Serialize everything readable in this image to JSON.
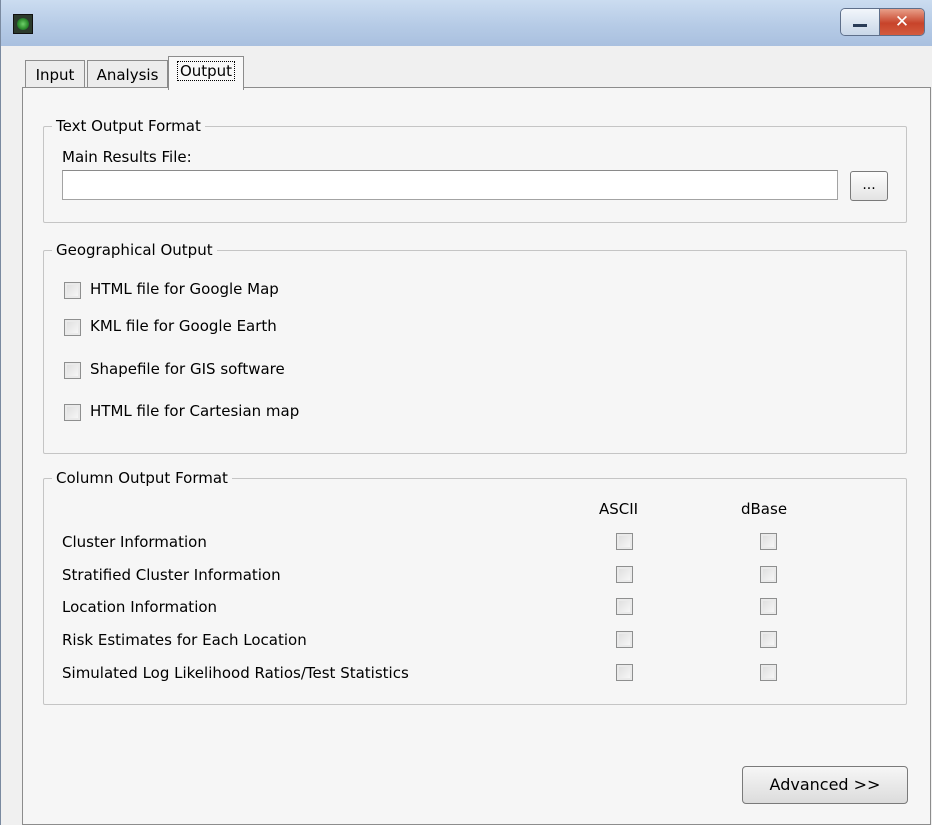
{
  "window": {
    "title": ""
  },
  "tabs": [
    {
      "label": "Input",
      "active": false
    },
    {
      "label": "Analysis",
      "active": false
    },
    {
      "label": "Output",
      "active": true
    }
  ],
  "text_output": {
    "legend": "Text Output Format",
    "main_results_label": "Main Results File:",
    "main_results_value": "",
    "browse_label": "..."
  },
  "geo_output": {
    "legend": "Geographical Output",
    "options": [
      {
        "label": "HTML file for Google Map",
        "checked": false
      },
      {
        "label": "KML file for Google Earth",
        "checked": false
      },
      {
        "label": "Shapefile for GIS software",
        "checked": false
      },
      {
        "label": "HTML file for Cartesian map",
        "checked": false
      }
    ]
  },
  "column_output": {
    "legend": "Column Output Format",
    "col_ascii": "ASCII",
    "col_dbase": "dBase",
    "rows": [
      {
        "label": "Cluster Information",
        "ascii": false,
        "dbase": false
      },
      {
        "label": "Stratified Cluster Information",
        "ascii": false,
        "dbase": false
      },
      {
        "label": "Location Information",
        "ascii": false,
        "dbase": false
      },
      {
        "label": "Risk Estimates for Each Location",
        "ascii": false,
        "dbase": false
      },
      {
        "label": "Simulated Log Likelihood Ratios/Test Statistics",
        "ascii": false,
        "dbase": false
      }
    ]
  },
  "advanced_label": "Advanced >>",
  "icons": {
    "app": "app-icon",
    "minimize": "minimize-icon",
    "close": "close-icon"
  },
  "colors": {
    "titlebar": "#b6cbe6",
    "close_button": "#c7432a",
    "panel": "#f6f6f6"
  }
}
